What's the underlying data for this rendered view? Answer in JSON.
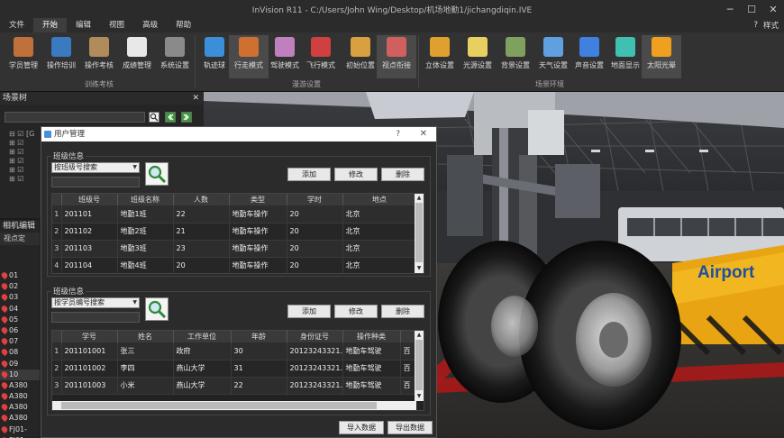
{
  "window": {
    "title": "InVision R11 - C:/Users/John Wing/Desktop/机场地勤1/jichangdiqin.IVE",
    "minimize": "─",
    "maximize": "☐",
    "close": "✕"
  },
  "menu": {
    "items": [
      "文件",
      "开始",
      "编辑",
      "视图",
      "高级",
      "帮助"
    ],
    "active_index": 1,
    "right_help": "?",
    "right_style": "样式"
  },
  "ribbon": {
    "items": [
      {
        "label": "学员管理",
        "icon": "user-manage-icon",
        "color": "#c0703a"
      },
      {
        "label": "操作培训",
        "icon": "book-icon",
        "color": "#3a7ac0"
      },
      {
        "label": "操作考核",
        "icon": "exam-user-icon",
        "color": "#b08c5a"
      },
      {
        "label": "成绩管理",
        "icon": "score-sheet-icon",
        "color": "#e8e8e8"
      },
      {
        "label": "系统设置",
        "icon": "tools-icon",
        "color": "#8a8a8a"
      },
      {
        "label": "轨迹球",
        "icon": "globe-icon",
        "color": "#3c8ed8"
      },
      {
        "label": "行走模式",
        "icon": "walk-icon",
        "color": "#d07030"
      },
      {
        "label": "驾驶模式",
        "icon": "car-icon",
        "color": "#c080c0"
      },
      {
        "label": "飞行模式",
        "icon": "airplane-icon",
        "color": "#d04040"
      },
      {
        "label": "初始位置",
        "icon": "home-icon",
        "color": "#d8a040"
      },
      {
        "label": "视点衔接",
        "icon": "link-icon",
        "color": "#d06060"
      },
      {
        "label": "立体设置",
        "icon": "3d-icon",
        "color": "#e0a030"
      },
      {
        "label": "光源设置",
        "icon": "bulb-icon",
        "color": "#e8d060"
      },
      {
        "label": "背景设置",
        "icon": "background-icon",
        "color": "#80a060"
      },
      {
        "label": "天气设置",
        "icon": "weather-icon",
        "color": "#60a0e0"
      },
      {
        "label": "声音设置",
        "icon": "music-icon",
        "color": "#4080e0"
      },
      {
        "label": "地面显示",
        "icon": "grid-icon",
        "color": "#40c0b0"
      },
      {
        "label": "太阳光晕",
        "icon": "sun-icon",
        "color": "#f0a020"
      }
    ],
    "groups": [
      "训练考核",
      "漫游设置",
      "场景环境"
    ]
  },
  "scene_tree": {
    "title": "场景树",
    "close": "✕",
    "tree_rows": [
      "⊟ ☑ [G",
      "   ⊞ ☑",
      "   ⊞ ☑",
      "   ⊞ ☑",
      "   ⊞ ☑",
      "   ⊞ ☑"
    ]
  },
  "camera": {
    "title": "相机编辑",
    "sub": "视点定",
    "items": [
      "01",
      "02",
      "03",
      "04",
      "05",
      "06",
      "07",
      "08",
      "09",
      "10",
      "A380",
      "A380",
      "A380",
      "A380",
      "FJ01-",
      "FJ01-"
    ],
    "selected_index": 9
  },
  "dialog": {
    "title": "用户管理",
    "help": "?",
    "close": "✕",
    "class_group": {
      "title": "班级信息",
      "combo": "按班级号搜索",
      "buttons": [
        "添加",
        "修改",
        "删除"
      ],
      "columns": [
        "",
        "班级号",
        "班级名称",
        "人数",
        "类型",
        "学时",
        "地点"
      ],
      "rows": [
        [
          "1",
          "201101",
          "地勤1班",
          "22",
          "地勤车操作",
          "20",
          "北京"
        ],
        [
          "2",
          "201102",
          "地勤2班",
          "21",
          "地勤车操作",
          "20",
          "北京"
        ],
        [
          "3",
          "201103",
          "地勤3班",
          "23",
          "地勤车操作",
          "20",
          "北京"
        ],
        [
          "4",
          "201104",
          "地勤4班",
          "20",
          "地勤车操作",
          "20",
          "北京"
        ]
      ]
    },
    "student_group": {
      "title": "班级信息",
      "combo": "按学员编号搜索",
      "buttons": [
        "添加",
        "修改",
        "删除"
      ],
      "columns": [
        "",
        "学号",
        "姓名",
        "工作单位",
        "年龄",
        "身份证号",
        "操作种类",
        ""
      ],
      "rows": [
        [
          "1",
          "201101001",
          "张三",
          "政府",
          "30",
          "20123243321...",
          "地勤车驾驶",
          "百"
        ],
        [
          "2",
          "201101002",
          "李四",
          "燕山大学",
          "31",
          "20123243321...",
          "地勤车驾驶",
          "百"
        ],
        [
          "3",
          "201101003",
          "小米",
          "燕山大学",
          "22",
          "20123243321...",
          "地勤车驾驶",
          "百"
        ]
      ]
    },
    "import_label": "导入数据",
    "export_label": "导出数据"
  },
  "viewport": {
    "tug_text": "Airport"
  }
}
